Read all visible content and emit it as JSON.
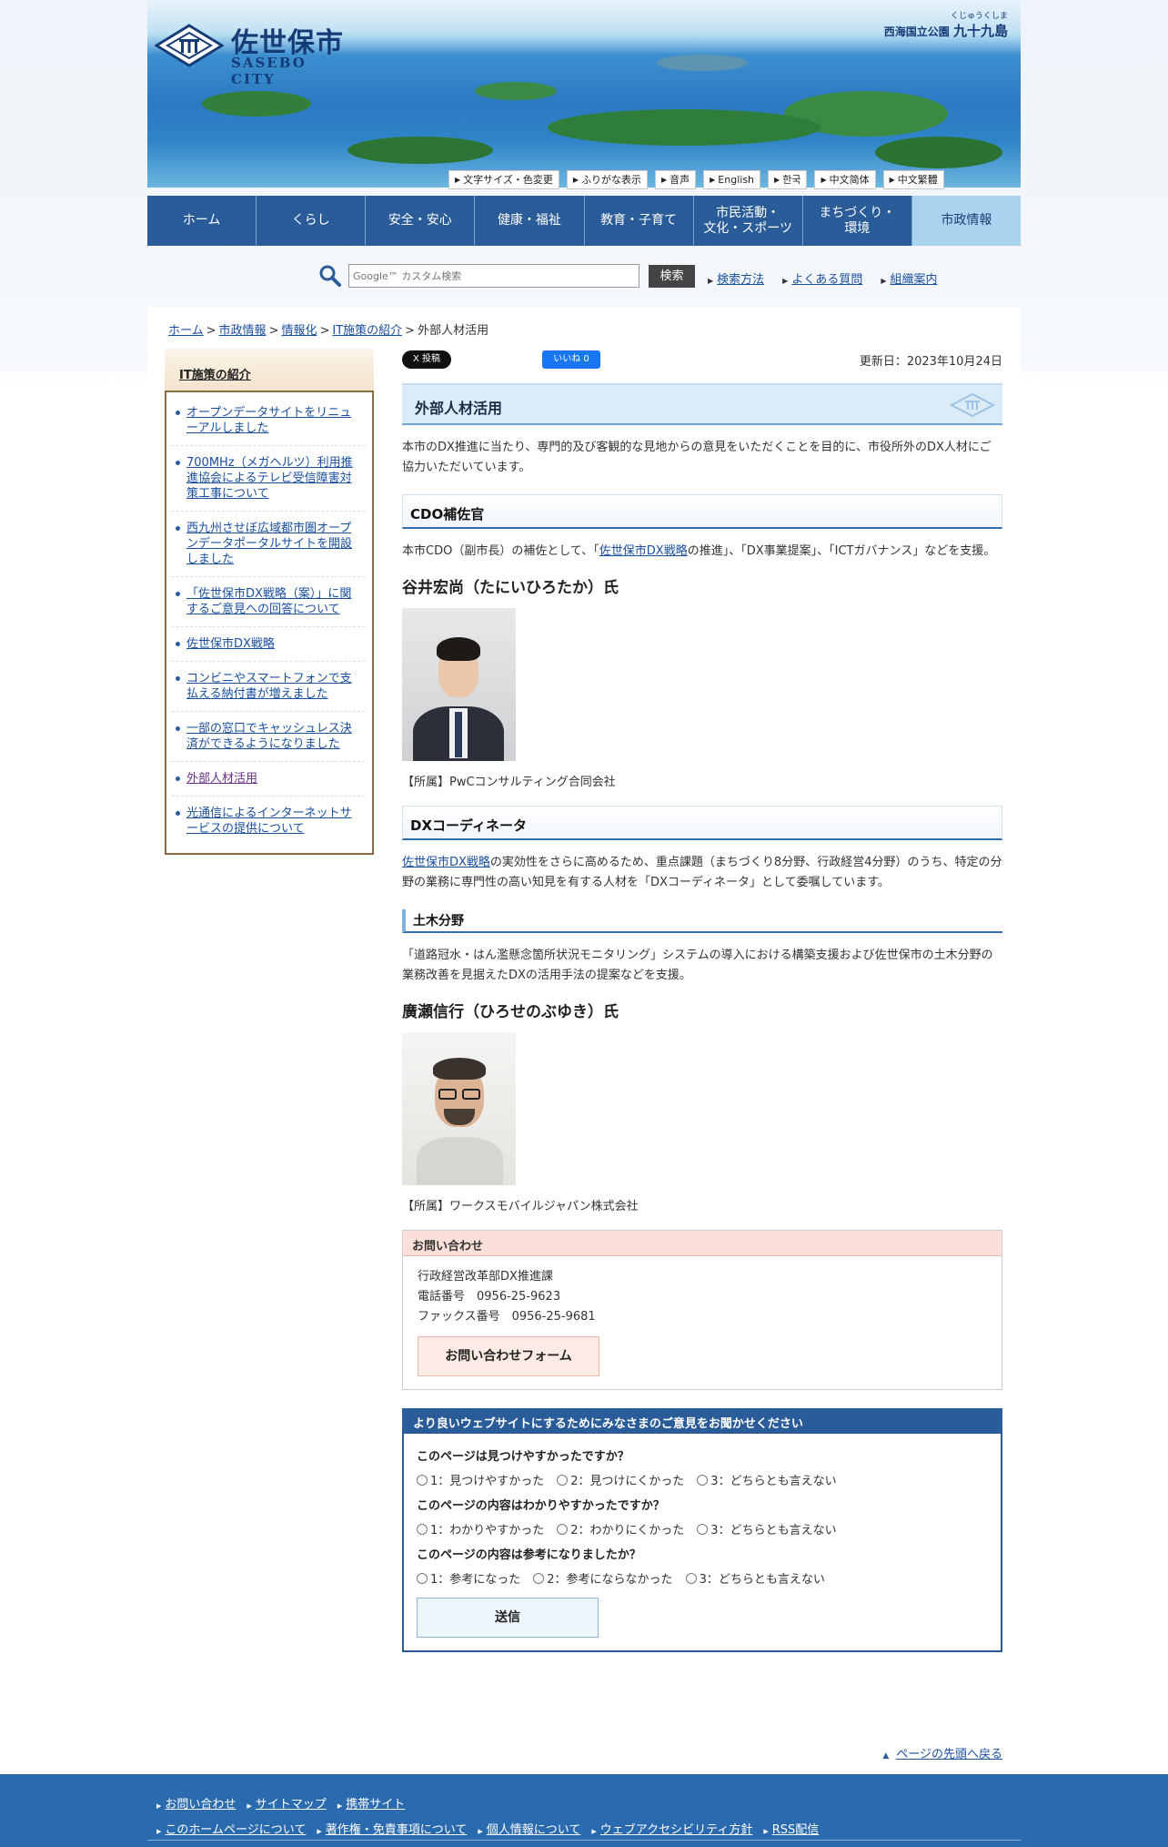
{
  "header": {
    "logo_title": "佐世保市",
    "logo_sub": "SASEBO CITY",
    "park_ruby": "くじゅうくしま",
    "park_prefix": "西海国立公園",
    "park_name": "九十九島"
  },
  "toolbar": [
    "文字サイズ・色変更",
    "ふりがな表示",
    "音声",
    "English",
    "한국",
    "中文简体",
    "中文繁體"
  ],
  "gnav": [
    "ホーム",
    "くらし",
    "安全・安心",
    "健康・福祉",
    "教育・子育て",
    "市民活動・\n文化・スポーツ",
    "まちづくり・\n環境",
    "市政情報"
  ],
  "search": {
    "placeholder": "Google™ カスタム検索",
    "button": "検索",
    "links": [
      "検索方法",
      "よくある質問",
      "組織案内"
    ]
  },
  "breadcrumbs": [
    "ホーム",
    "市政情報",
    "情報化",
    "IT施策の紹介",
    "外部人材活用"
  ],
  "sidebar": {
    "title": "IT施策の紹介",
    "items": [
      "オープンデータサイトをリニューアルしました",
      "700MHz（メガヘルツ）利用推進協会によるテレビ受信障害対策工事について",
      "西九州させぼ広域都市圏オープンデータポータルサイトを開設しました",
      "「佐世保市DX戦略（案）」に関するご意見への回答について",
      "佐世保市DX戦略",
      "コンビニやスマートフォンで支払える納付書が増えました",
      "一部の窓口でキャッシュレス決済ができるようになりました",
      "外部人材活用",
      "光通信によるインターネットサービスの提供について"
    ]
  },
  "social": {
    "x": "X 投稿",
    "fb": "いいね 0"
  },
  "updated": "更新日：2023年10月24日",
  "page_title": "外部人材活用",
  "intro": "本市のDX推進に当たり、専門的及び客観的な見地からの意見をいただくことを目的に、市役所外のDX人材にご協力いただいています。",
  "cdo": {
    "heading": "CDO補佐官",
    "text_before": "本市CDO（副市長）の補佐として、「",
    "text_link": "佐世保市DX戦略",
    "text_after": "の推進」、「DX事業提案」、「ICTガバナンス」などを支援。",
    "person": "谷井宏尚（たにいひろたか）氏",
    "affiliation": "【所属】PwCコンサルティング合同会社"
  },
  "coordinator": {
    "heading": "DXコーディネータ",
    "text_link": "佐世保市DX戦略",
    "text_after": "の実効性をさらに高めるため、重点課題（まちづくり8分野、行政経営4分野）のうち、特定の分野の業務に専門性の高い知見を有する人材を「DXコーディネータ」として委嘱しています。",
    "sub_heading": "土木分野",
    "sub_text": "「道路冠水・はん濫懸念箇所状況モニタリング」システムの導入における構築支援および佐世保市の土木分野の業務改善を見据えたDXの活用手法の提案などを支援。",
    "person": "廣瀬信行（ひろせのぶゆき）氏",
    "affiliation": "【所属】ワークスモバイルジャパン株式会社"
  },
  "inquiry": {
    "heading": "お問い合わせ",
    "dept": "行政経営改革部DX推進課",
    "phone": "電話番号　0956-25-9623",
    "fax": "ファックス番号　0956-25-9681",
    "button": "お問い合わせフォーム"
  },
  "survey": {
    "heading": "より良いウェブサイトにするためにみなさまのご意見をお聞かせください",
    "questions": [
      {
        "q": "このページは見つけやすかったですか？",
        "options": [
          "1：見つけやすかった",
          "2：見つけにくかった",
          "3：どちらとも言えない"
        ]
      },
      {
        "q": "このページの内容はわかりやすかったですか？",
        "options": [
          "1：わかりやすかった",
          "2：わかりにくかった",
          "3：どちらとも言えない"
        ]
      },
      {
        "q": "このページの内容は参考になりましたか？",
        "options": [
          "1：参考になった",
          "2：参考にならなかった",
          "3：どちらとも言えない"
        ]
      }
    ],
    "submit": "送信"
  },
  "to_top": "ページの先頭へ戻る",
  "footer": {
    "row1": [
      "お問い合わせ",
      "サイトマップ",
      "携帯サイト"
    ],
    "row2": [
      "このホームページについて",
      "著作権・免責事項について",
      "個人情報について",
      "ウェブアクセシビリティ方針",
      "RSS配信"
    ]
  },
  "colors": {
    "nav_bg": "#2a5c9a",
    "nav_active": "#a9d3ef",
    "footer_bg": "#2a6bb0",
    "link": "#1a4fa0",
    "inquiry_head": "#fae0d8"
  }
}
